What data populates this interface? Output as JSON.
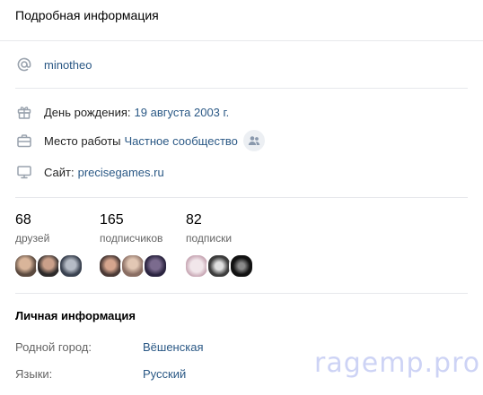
{
  "header": {
    "title": "Подробная информация"
  },
  "contact": {
    "username": "minotheo"
  },
  "details": {
    "birthday_label": "День рождения:",
    "birthday_value": "19 августа 2003 г.",
    "work_label": "Место работы",
    "work_value": "Частное сообщество",
    "site_label": "Сайт:",
    "site_value": "precisegames.ru"
  },
  "stats": [
    {
      "count": "68",
      "caption": "друзей"
    },
    {
      "count": "165",
      "caption": "подписчиков"
    },
    {
      "count": "82",
      "caption": "подписки"
    }
  ],
  "personal": {
    "title": "Личная информация",
    "hometown_label": "Родной город:",
    "hometown_value": "Вёшенская",
    "languages_label": "Языки:",
    "languages_value": "Русский"
  },
  "watermark": "ragemp.pro",
  "colors": {
    "link": "#2a5885",
    "icon": "#99a2ad",
    "divider": "#e7e8ec"
  }
}
